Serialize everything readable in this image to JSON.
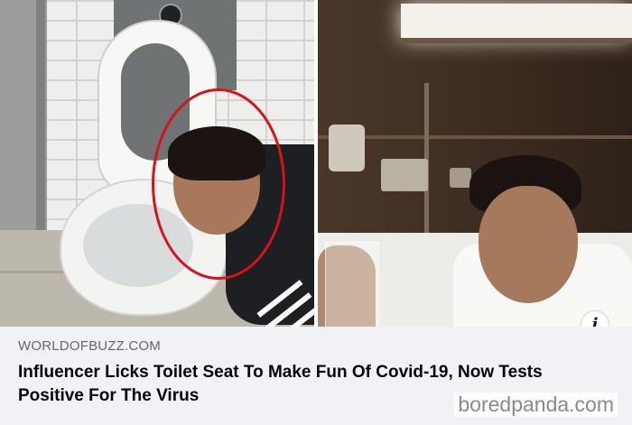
{
  "link_preview": {
    "source": "WORLDOFBUZZ.COM",
    "headline": "Influencer Licks Toilet Seat To Make Fun Of Covid-19, Now Tests Positive For The Virus",
    "info_icon": "i"
  },
  "watermark": "boredpanda.com",
  "colors": {
    "caption_background": "#f0f2f5",
    "source_text": "#65676b",
    "headline_text": "#050505",
    "highlight_circle": "#d8121a"
  }
}
